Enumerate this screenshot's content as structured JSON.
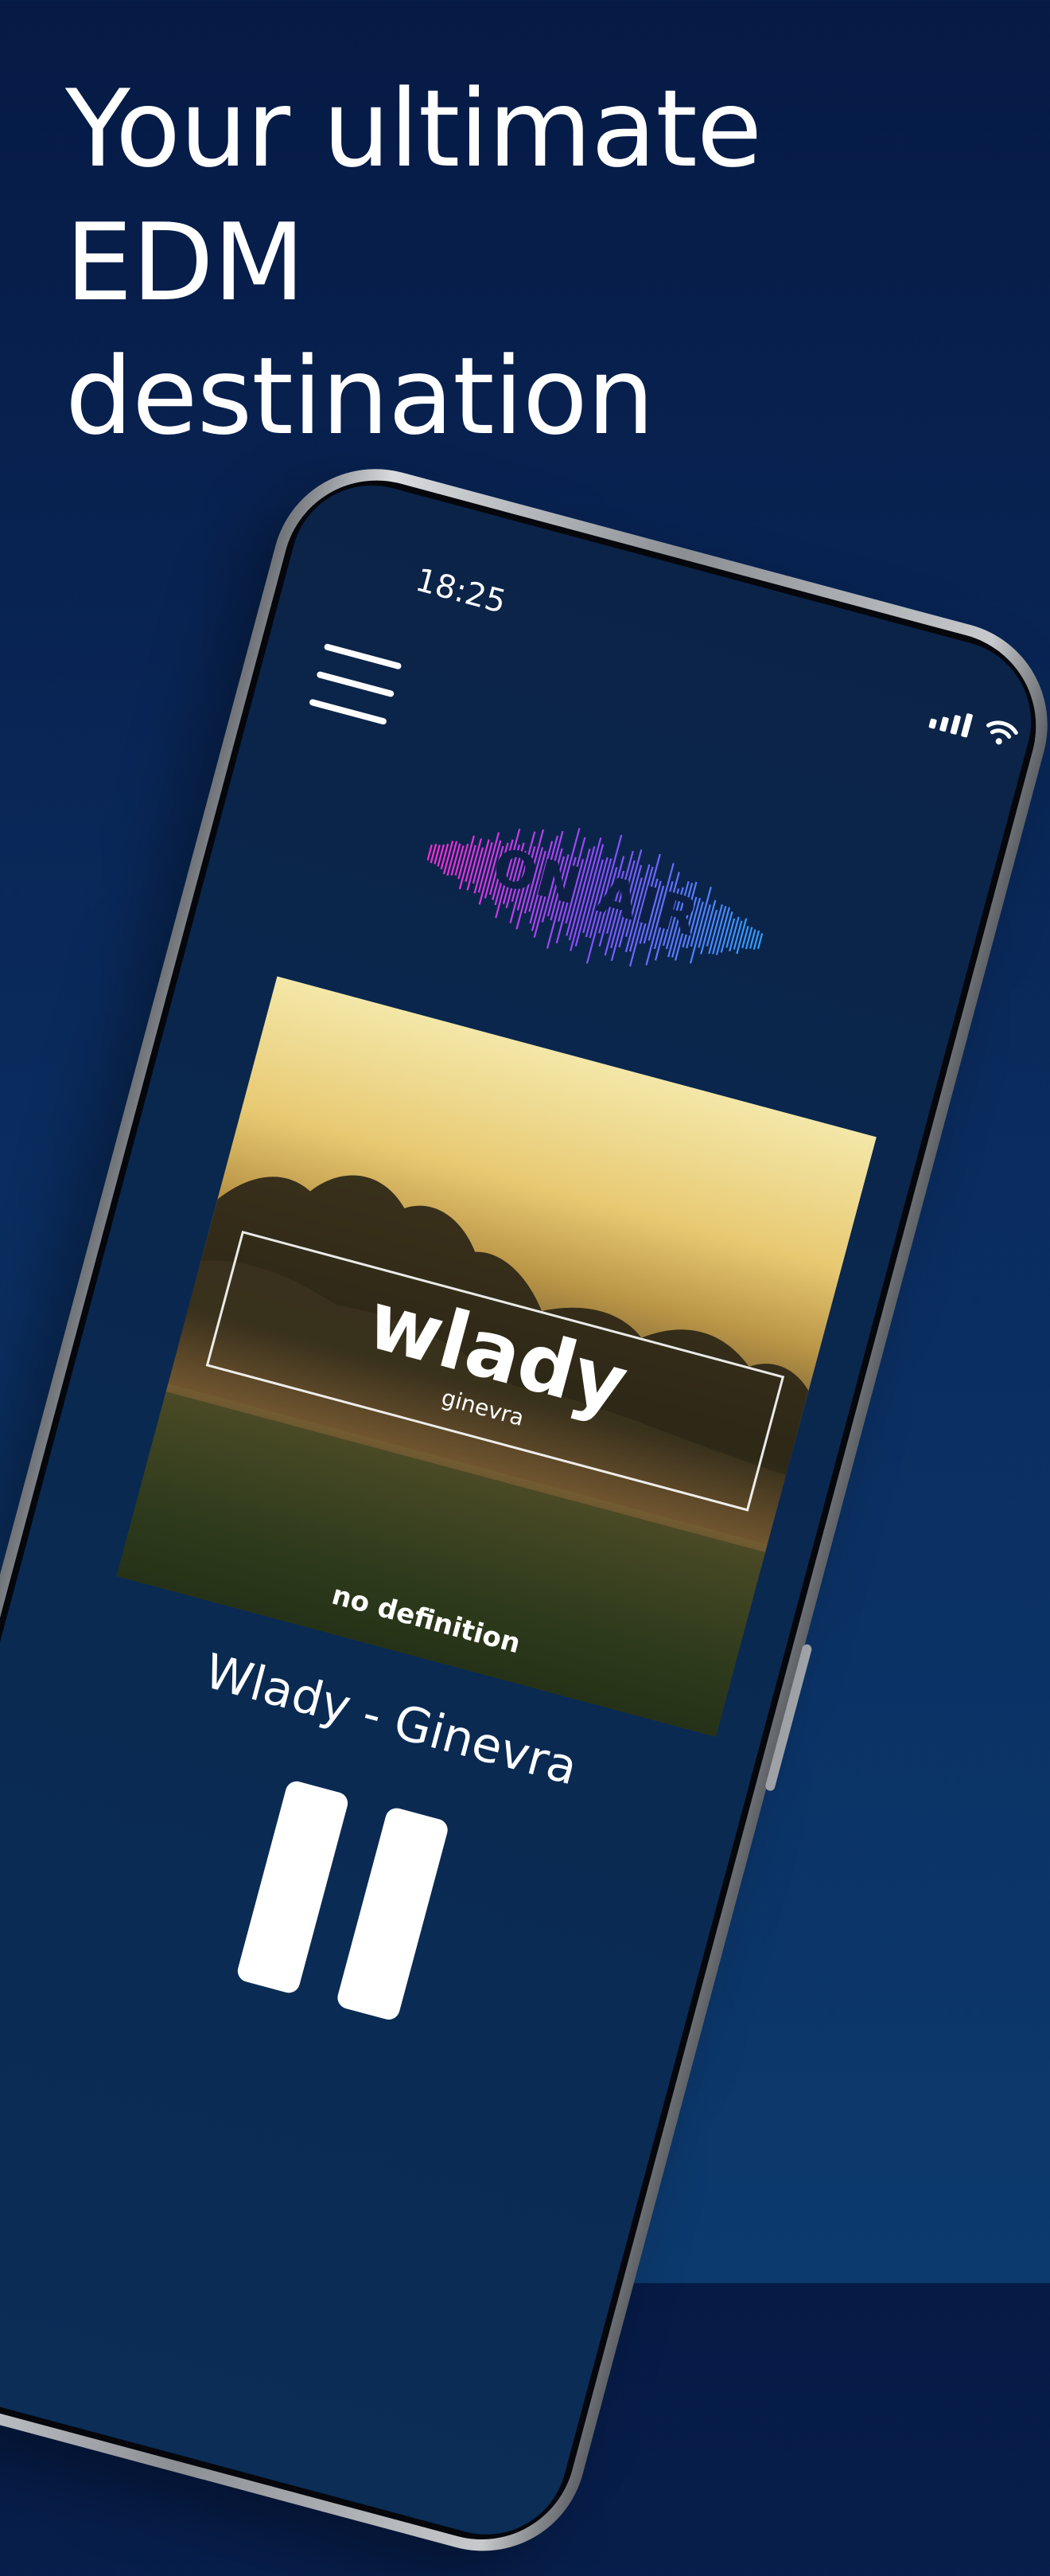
{
  "headline": {
    "line1": "Your ultimate EDM",
    "line2": "destination"
  },
  "status_bar": {
    "time": "18:25",
    "icons": [
      "signal-icon",
      "wifi-icon"
    ]
  },
  "player": {
    "logo_text": "ON AIR",
    "cover": {
      "artist_text": "wlady",
      "track_text": "ginevra",
      "label_text": "no definition"
    },
    "now_playing": "Wlady - Ginevra",
    "control_icon": "pause-icon",
    "menu_icon": "hamburger-menu-icon"
  },
  "colors": {
    "background": "#0a2a5c",
    "screen": "#0b2347",
    "text": "#ffffff",
    "onair_pink": "#ff2bd6",
    "onair_purple": "#8a4dff",
    "onair_blue": "#2fa0ff"
  }
}
